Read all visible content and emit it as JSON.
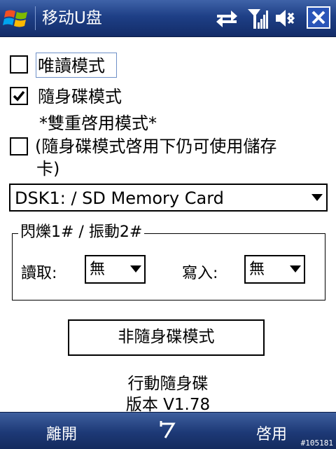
{
  "app": {
    "title": "移动U盘"
  },
  "options": {
    "readonly_label": "唯讀模式",
    "readonly_checked": false,
    "usb_mode_label": "隨身碟模式",
    "usb_mode_checked": true,
    "dual_mode_heading": "*雙重啓用模式*",
    "dual_mode_label_line1": "(隨身碟模式啓用下仍可使用儲存",
    "dual_mode_label_line2": "卡)",
    "dual_mode_checked": false
  },
  "storage_select": {
    "value": "DSK1: / SD Memory Card"
  },
  "indicator_group": {
    "title": "閃爍1# / 振動2#",
    "read_label": "讀取:",
    "read_value": "無",
    "write_label": "寫入:",
    "write_value": "無"
  },
  "mode_button": {
    "label": "非隨身碟模式"
  },
  "info": {
    "product": "行動隨身碟",
    "version": "版本 V1.78"
  },
  "softkeys": {
    "left": "離開",
    "right": "啓用"
  },
  "watermark": "#105181",
  "colors": {
    "titlebar": "#1e3f86",
    "focus": "#6e90c8"
  },
  "icons": {
    "start": "windows-flag-icon",
    "connectivity": "sync-arrows-icon",
    "signal": "signal-strength-icon",
    "volume": "speaker-muted-icon",
    "close": "close-icon",
    "center_soft": "undo-arrow-icon"
  }
}
